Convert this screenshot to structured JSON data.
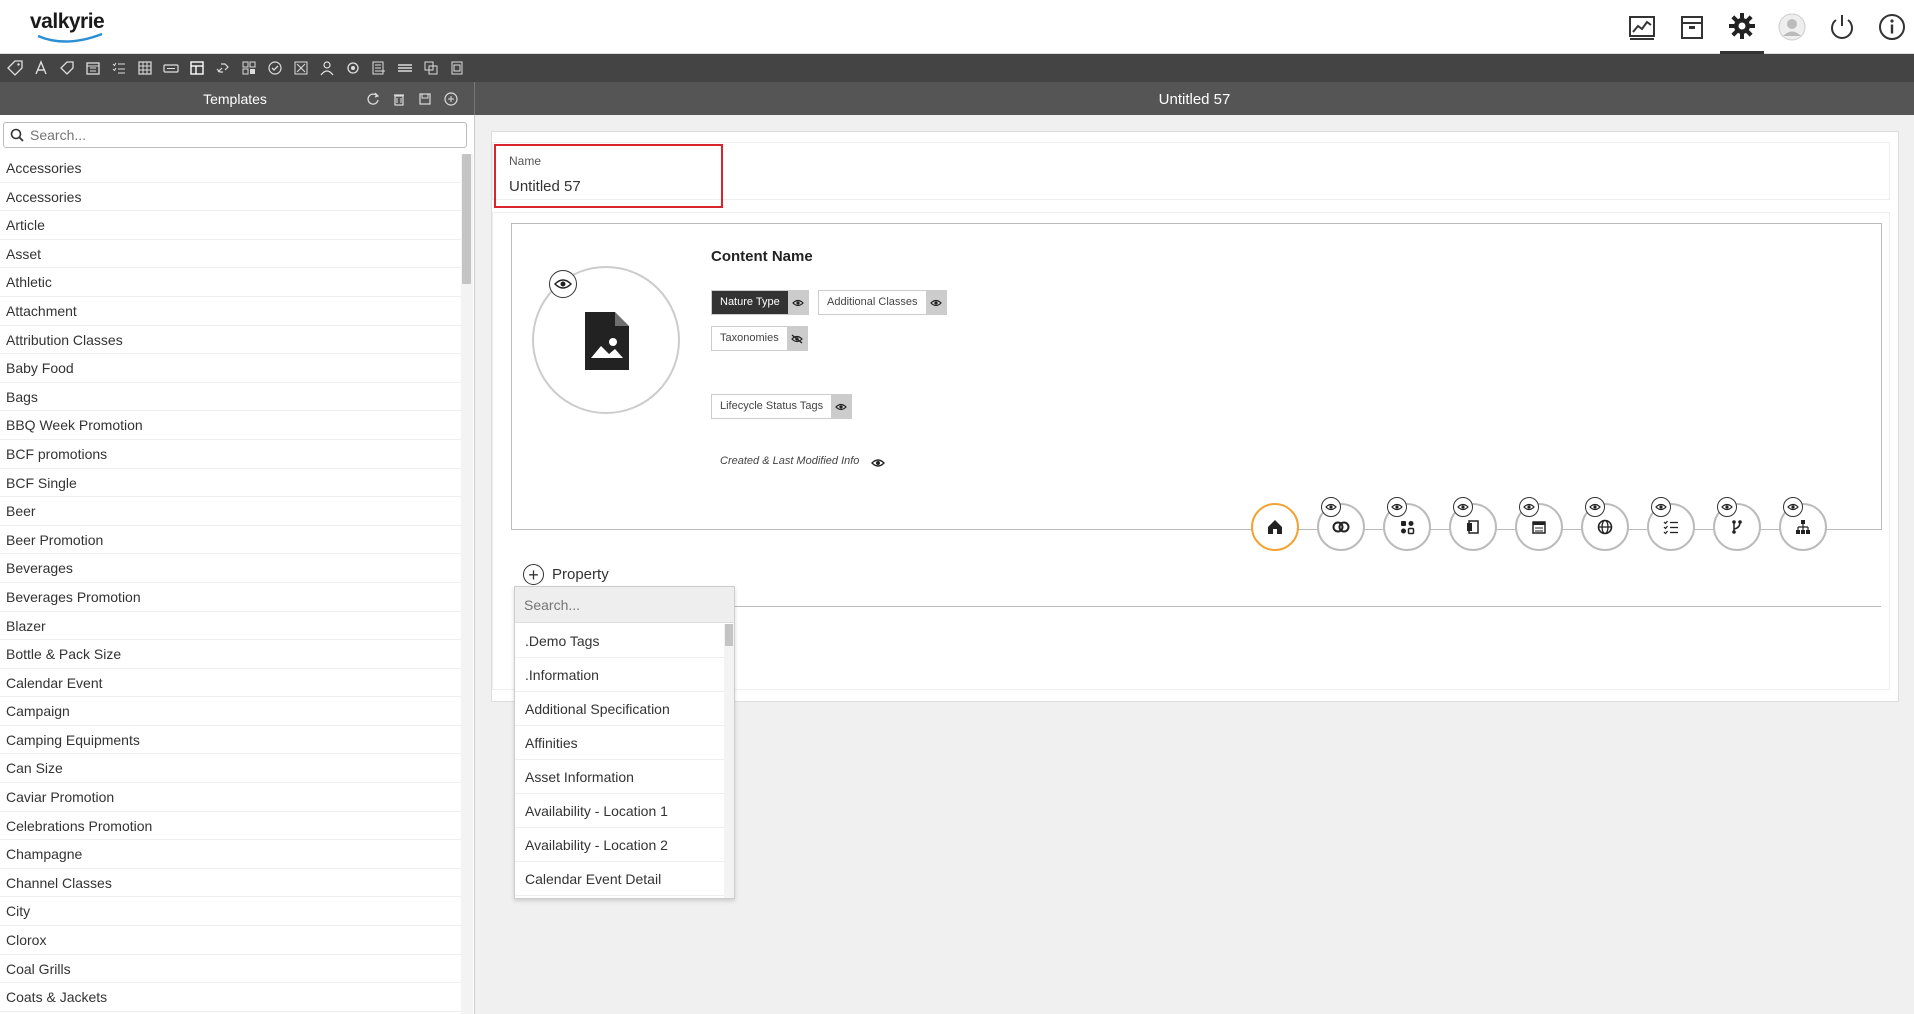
{
  "app": {
    "logo_text": "valkyrie"
  },
  "header_icons": [
    {
      "name": "dashboard-chart-icon",
      "active": false
    },
    {
      "name": "archive-box-icon",
      "active": false
    },
    {
      "name": "gear-icon",
      "active": true
    },
    {
      "name": "user-avatar-icon",
      "active": false
    },
    {
      "name": "power-icon",
      "active": false
    },
    {
      "name": "info-icon",
      "active": false
    }
  ],
  "toolbar_icons": [
    "tag-icon",
    "text-icon",
    "label-icon",
    "calendar-icon",
    "checklist-icon",
    "table-icon",
    "button-icon",
    "layout-icon",
    "link-icon",
    "grid-icon",
    "check-circle-icon",
    "nodes-icon",
    "user-icon",
    "settings-icon",
    "list-icon",
    "divider-icon",
    "copy-icon",
    "paste-icon"
  ],
  "sidebar": {
    "title": "Templates",
    "search_placeholder": "Search...",
    "items": [
      "Accessories",
      "Accessories",
      "Article",
      "Asset",
      "Athletic",
      "Attachment",
      "Attribution Classes",
      "Baby Food",
      "Bags",
      "BBQ Week Promotion",
      "BCF promotions",
      "BCF Single",
      "Beer",
      "Beer Promotion",
      "Beverages",
      "Beverages Promotion",
      "Blazer",
      "Bottle & Pack Size",
      "Calendar Event",
      "Campaign",
      "Camping Equipments",
      "Can Size",
      "Caviar Promotion",
      "Celebrations Promotion",
      "Champagne",
      "Channel Classes",
      "City",
      "Clorox",
      "Coal Grills",
      "Coats & Jackets"
    ]
  },
  "main": {
    "title": "Untitled 57",
    "name_label": "Name",
    "name_value": "Untitled 57",
    "content_name": "Content Name",
    "chips": {
      "nature_type": "Nature Type",
      "additional_classes": "Additional Classes",
      "taxonomies": "Taxonomies",
      "lifecycle": "Lifecycle Status Tags"
    },
    "created_info": "Created & Last Modified Info",
    "tabs": [
      "home-icon",
      "relations-icon",
      "apps-icon",
      "clipboard-icon",
      "calendar-icon",
      "globe-icon",
      "checklist-icon",
      "branch-icon",
      "hierarchy-icon"
    ],
    "add_property_label": "Property"
  },
  "dropdown": {
    "search_placeholder": "Search...",
    "items": [
      ".Demo Tags",
      ".Information",
      "Additional Specification",
      "Affinities",
      "Asset Information",
      "Availability - Location 1",
      "Availability - Location 2",
      "Calendar Event Detail"
    ]
  },
  "colors": {
    "highlight_border": "#d9232d",
    "active_tab": "#f3a333",
    "toolbar_bg": "#444444",
    "subbar_bg": "#555555"
  }
}
